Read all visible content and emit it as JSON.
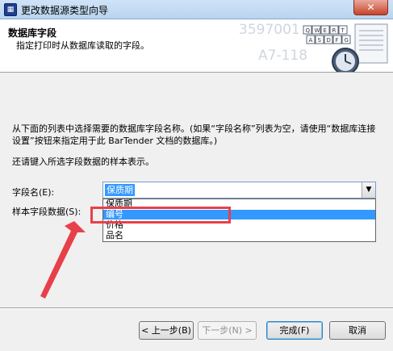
{
  "window": {
    "title": "更改数据源类型向导",
    "icon_glyph": "▦",
    "close_glyph": "✕"
  },
  "header": {
    "title": "数据库字段",
    "subtitle": "指定打印时从数据库读取的字段。",
    "decoration_text_1": "3597001",
    "decoration_text_2": "A7-118",
    "keyboard_keys": [
      "Q",
      "W",
      "E",
      "R",
      "T",
      "A",
      "S",
      "D",
      "F",
      "G"
    ]
  },
  "body": {
    "description": "从下面的列表中选择需要的数据库字段名称。(如果“字段名称”列表为空，请使用“数据库连接设置”按钮来指定用于此 BarTender 文档的数据库。)",
    "hint": "还请键入所选字段数据的样本表示。"
  },
  "form": {
    "field_label": "字段名(E):",
    "field_value": "保质期",
    "sample_label": "样本字段数据(S):",
    "dropdown_options": [
      {
        "label": "保质期",
        "selected": false
      },
      {
        "label": "编号",
        "selected": true
      },
      {
        "label": "价格",
        "selected": false
      },
      {
        "label": "品名",
        "selected": false
      }
    ]
  },
  "buttons": {
    "back": "< 上一步(B)",
    "next": "下一步(N) >",
    "finish": "完成(F)",
    "cancel": "取消"
  },
  "colors": {
    "selection": "#3399ff",
    "annotation": "#e8404a"
  }
}
